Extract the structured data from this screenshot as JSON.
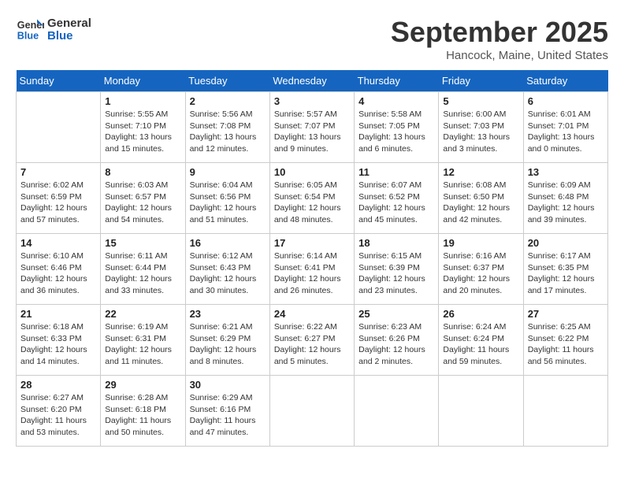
{
  "header": {
    "logo_line1": "General",
    "logo_line2": "Blue",
    "month": "September 2025",
    "location": "Hancock, Maine, United States"
  },
  "weekdays": [
    "Sunday",
    "Monday",
    "Tuesday",
    "Wednesday",
    "Thursday",
    "Friday",
    "Saturday"
  ],
  "weeks": [
    [
      {
        "day": "",
        "info": ""
      },
      {
        "day": "1",
        "info": "Sunrise: 5:55 AM\nSunset: 7:10 PM\nDaylight: 13 hours\nand 15 minutes."
      },
      {
        "day": "2",
        "info": "Sunrise: 5:56 AM\nSunset: 7:08 PM\nDaylight: 13 hours\nand 12 minutes."
      },
      {
        "day": "3",
        "info": "Sunrise: 5:57 AM\nSunset: 7:07 PM\nDaylight: 13 hours\nand 9 minutes."
      },
      {
        "day": "4",
        "info": "Sunrise: 5:58 AM\nSunset: 7:05 PM\nDaylight: 13 hours\nand 6 minutes."
      },
      {
        "day": "5",
        "info": "Sunrise: 6:00 AM\nSunset: 7:03 PM\nDaylight: 13 hours\nand 3 minutes."
      },
      {
        "day": "6",
        "info": "Sunrise: 6:01 AM\nSunset: 7:01 PM\nDaylight: 13 hours\nand 0 minutes."
      }
    ],
    [
      {
        "day": "7",
        "info": "Sunrise: 6:02 AM\nSunset: 6:59 PM\nDaylight: 12 hours\nand 57 minutes."
      },
      {
        "day": "8",
        "info": "Sunrise: 6:03 AM\nSunset: 6:57 PM\nDaylight: 12 hours\nand 54 minutes."
      },
      {
        "day": "9",
        "info": "Sunrise: 6:04 AM\nSunset: 6:56 PM\nDaylight: 12 hours\nand 51 minutes."
      },
      {
        "day": "10",
        "info": "Sunrise: 6:05 AM\nSunset: 6:54 PM\nDaylight: 12 hours\nand 48 minutes."
      },
      {
        "day": "11",
        "info": "Sunrise: 6:07 AM\nSunset: 6:52 PM\nDaylight: 12 hours\nand 45 minutes."
      },
      {
        "day": "12",
        "info": "Sunrise: 6:08 AM\nSunset: 6:50 PM\nDaylight: 12 hours\nand 42 minutes."
      },
      {
        "day": "13",
        "info": "Sunrise: 6:09 AM\nSunset: 6:48 PM\nDaylight: 12 hours\nand 39 minutes."
      }
    ],
    [
      {
        "day": "14",
        "info": "Sunrise: 6:10 AM\nSunset: 6:46 PM\nDaylight: 12 hours\nand 36 minutes."
      },
      {
        "day": "15",
        "info": "Sunrise: 6:11 AM\nSunset: 6:44 PM\nDaylight: 12 hours\nand 33 minutes."
      },
      {
        "day": "16",
        "info": "Sunrise: 6:12 AM\nSunset: 6:43 PM\nDaylight: 12 hours\nand 30 minutes."
      },
      {
        "day": "17",
        "info": "Sunrise: 6:14 AM\nSunset: 6:41 PM\nDaylight: 12 hours\nand 26 minutes."
      },
      {
        "day": "18",
        "info": "Sunrise: 6:15 AM\nSunset: 6:39 PM\nDaylight: 12 hours\nand 23 minutes."
      },
      {
        "day": "19",
        "info": "Sunrise: 6:16 AM\nSunset: 6:37 PM\nDaylight: 12 hours\nand 20 minutes."
      },
      {
        "day": "20",
        "info": "Sunrise: 6:17 AM\nSunset: 6:35 PM\nDaylight: 12 hours\nand 17 minutes."
      }
    ],
    [
      {
        "day": "21",
        "info": "Sunrise: 6:18 AM\nSunset: 6:33 PM\nDaylight: 12 hours\nand 14 minutes."
      },
      {
        "day": "22",
        "info": "Sunrise: 6:19 AM\nSunset: 6:31 PM\nDaylight: 12 hours\nand 11 minutes."
      },
      {
        "day": "23",
        "info": "Sunrise: 6:21 AM\nSunset: 6:29 PM\nDaylight: 12 hours\nand 8 minutes."
      },
      {
        "day": "24",
        "info": "Sunrise: 6:22 AM\nSunset: 6:27 PM\nDaylight: 12 hours\nand 5 minutes."
      },
      {
        "day": "25",
        "info": "Sunrise: 6:23 AM\nSunset: 6:26 PM\nDaylight: 12 hours\nand 2 minutes."
      },
      {
        "day": "26",
        "info": "Sunrise: 6:24 AM\nSunset: 6:24 PM\nDaylight: 11 hours\nand 59 minutes."
      },
      {
        "day": "27",
        "info": "Sunrise: 6:25 AM\nSunset: 6:22 PM\nDaylight: 11 hours\nand 56 minutes."
      }
    ],
    [
      {
        "day": "28",
        "info": "Sunrise: 6:27 AM\nSunset: 6:20 PM\nDaylight: 11 hours\nand 53 minutes."
      },
      {
        "day": "29",
        "info": "Sunrise: 6:28 AM\nSunset: 6:18 PM\nDaylight: 11 hours\nand 50 minutes."
      },
      {
        "day": "30",
        "info": "Sunrise: 6:29 AM\nSunset: 6:16 PM\nDaylight: 11 hours\nand 47 minutes."
      },
      {
        "day": "",
        "info": ""
      },
      {
        "day": "",
        "info": ""
      },
      {
        "day": "",
        "info": ""
      },
      {
        "day": "",
        "info": ""
      }
    ]
  ]
}
